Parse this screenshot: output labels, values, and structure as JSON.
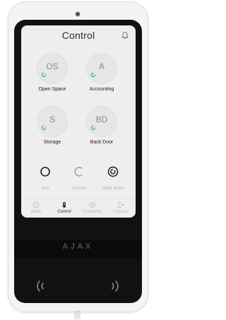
{
  "screen": {
    "title": "Control",
    "notification_icon": "bell-icon"
  },
  "groups": [
    {
      "abbr": "OS",
      "label": "Open Space",
      "status": "disarmed",
      "status_color": "#2fb85c"
    },
    {
      "abbr": "A",
      "label": "Accounting",
      "status": "disarmed",
      "status_color": "#2fb85c"
    },
    {
      "abbr": "S",
      "label": "Storage",
      "status": "disarmed",
      "status_color": "#2fb85c"
    },
    {
      "abbr": "BD",
      "label": "Back Door",
      "status": "disarmed",
      "status_color": "#2fb85c"
    }
  ],
  "controls": [
    {
      "label": "Arm",
      "icon": "arm-icon"
    },
    {
      "label": "Disarm",
      "icon": "disarm-icon"
    },
    {
      "label": "Night Mode",
      "icon": "night-mode-icon"
    }
  ],
  "tabs": [
    {
      "label": "Panic",
      "icon": "panic-icon",
      "active": false
    },
    {
      "label": "Control",
      "icon": "control-icon",
      "active": true
    },
    {
      "label": "Scenarios",
      "icon": "scenarios-icon",
      "active": false
    },
    {
      "label": "Log out",
      "icon": "logout-icon",
      "active": false
    }
  ],
  "device": {
    "brand": "AJAX",
    "reader_icon": "contactless-icon"
  },
  "colors": {
    "accent_green": "#2fb85c",
    "body": "#f4f4f4",
    "bezel": "#111111",
    "screen": "#eeeeee"
  }
}
